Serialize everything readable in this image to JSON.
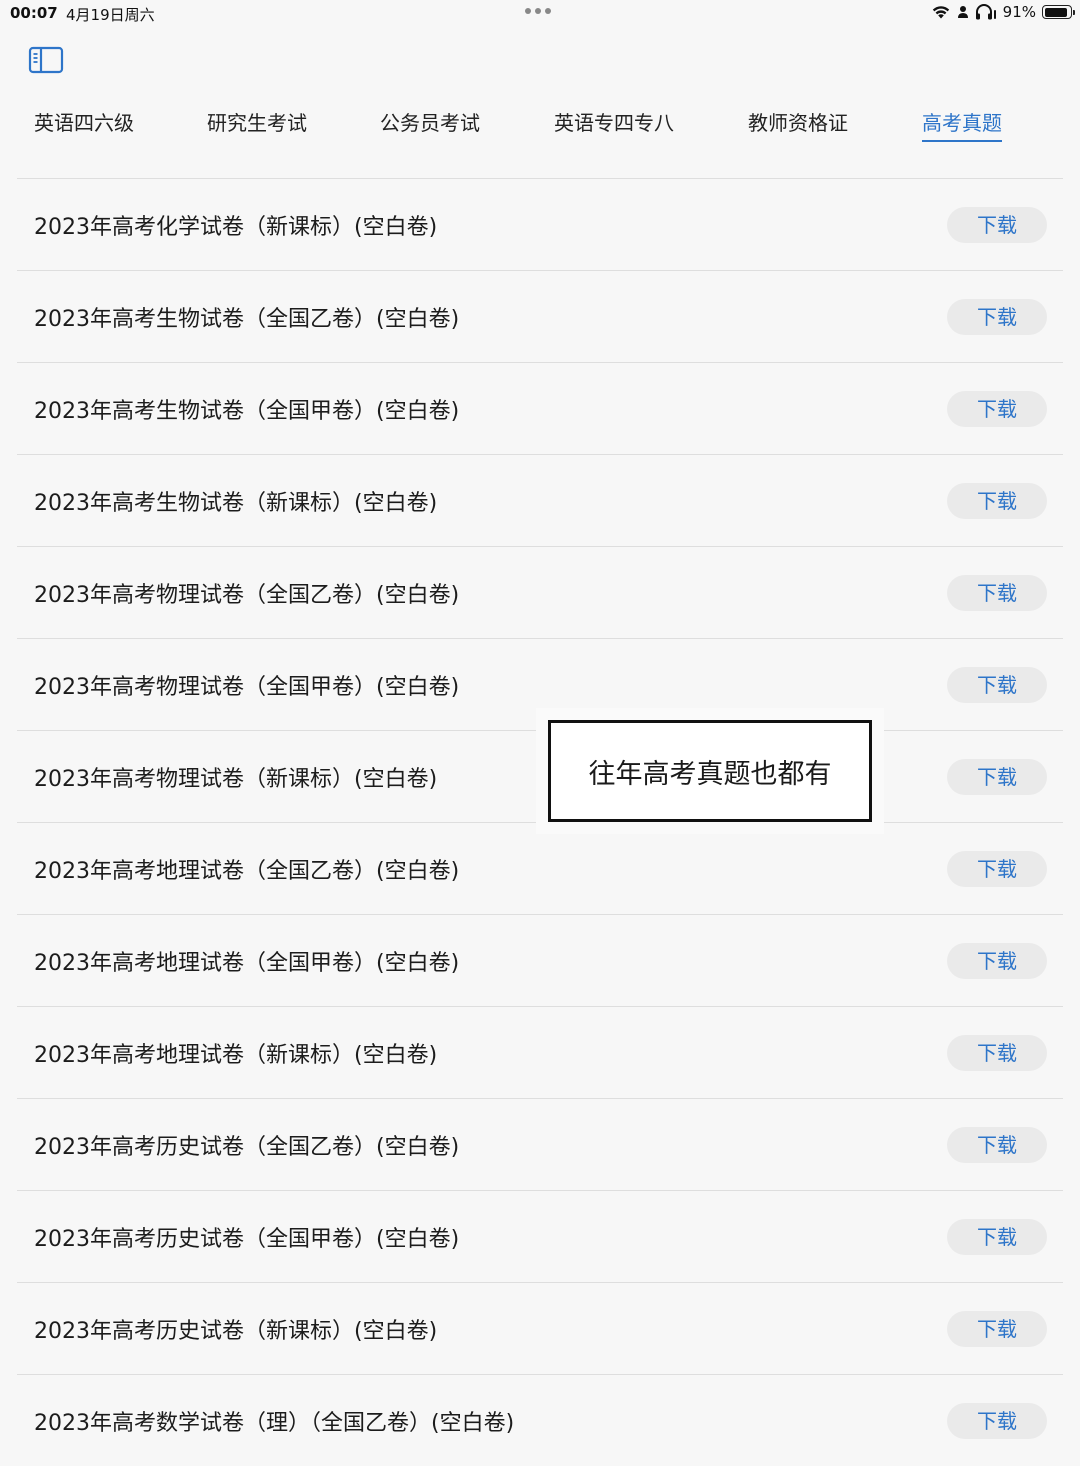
{
  "status_bar": {
    "time": "00:07",
    "date": "4月19日周六",
    "battery_text": "91%",
    "battery_level": 0.91
  },
  "icons": {
    "sidebar_toggle": "sidebar-toggle-icon",
    "wifi": "wifi-icon",
    "person": "person-icon",
    "headphones": "headphones-icon",
    "battery": "battery-icon"
  },
  "colors": {
    "accent": "#2e75c9",
    "button_bg": "#eaeaea"
  },
  "tabs": [
    {
      "label": "英语四六级",
      "active": false
    },
    {
      "label": "研究生考试",
      "active": false
    },
    {
      "label": "公务员考试",
      "active": false
    },
    {
      "label": "英语专四专八",
      "active": false
    },
    {
      "label": "教师资格证",
      "active": false
    },
    {
      "label": "高考真题",
      "active": true
    }
  ],
  "download_label": "下载",
  "items": [
    "2023年高考化学试卷（新课标）(空白卷)",
    "2023年高考生物试卷（全国乙卷）(空白卷)",
    "2023年高考生物试卷（全国甲卷）(空白卷)",
    "2023年高考生物试卷（新课标）(空白卷)",
    "2023年高考物理试卷（全国乙卷）(空白卷)",
    "2023年高考物理试卷（全国甲卷）(空白卷)",
    "2023年高考物理试卷（新课标）(空白卷)",
    "2023年高考地理试卷（全国乙卷）(空白卷)",
    "2023年高考地理试卷（全国甲卷）(空白卷)",
    "2023年高考地理试卷（新课标）(空白卷)",
    "2023年高考历史试卷（全国乙卷）(空白卷)",
    "2023年高考历史试卷（全国甲卷）(空白卷)",
    "2023年高考历史试卷（新课标）(空白卷)",
    "2023年高考数学试卷（理）（全国乙卷）(空白卷)"
  ],
  "overlay": {
    "text": "往年高考真题也都有"
  }
}
